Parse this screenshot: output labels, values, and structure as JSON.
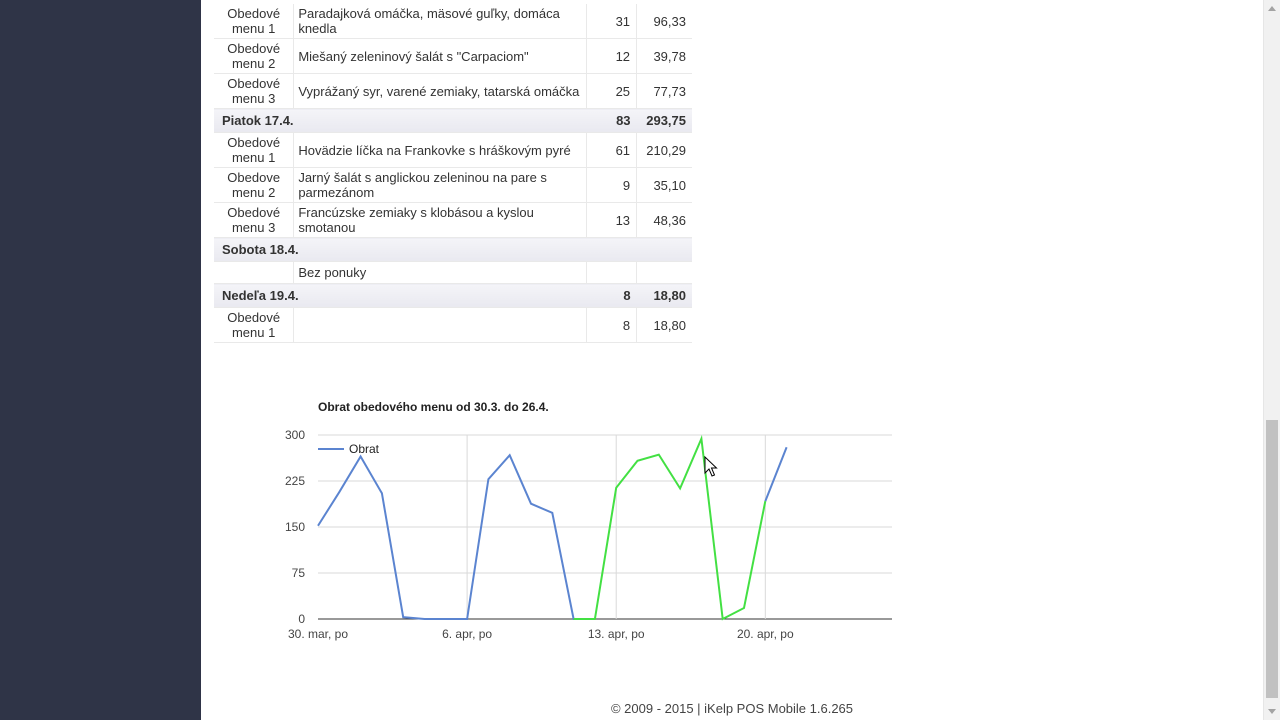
{
  "table": {
    "rows": [
      {
        "kind": "item",
        "menu": "Obedové menu 1",
        "dish": "Paradajková omáčka, mäsové guľky, domáca knedla",
        "qty": "31",
        "sum": "96,33"
      },
      {
        "kind": "item",
        "menu": "Obedové menu 2",
        "dish": "Miešaný zeleninový šalát s \"Carpaciom\"",
        "qty": "12",
        "sum": "39,78"
      },
      {
        "kind": "item",
        "menu": "Obedové menu 3",
        "dish": "Vyprážaný syr, varené zemiaky, tatarská omáčka",
        "qty": "25",
        "sum": "77,73"
      },
      {
        "kind": "day",
        "day": "Piatok 17.4.",
        "qty": "83",
        "sum": "293,75"
      },
      {
        "kind": "item",
        "menu": "Obedové menu 1",
        "dish": "Hovädzie líčka na Frankovke s hráškovým pyré",
        "qty": "61",
        "sum": "210,29"
      },
      {
        "kind": "item",
        "menu": "Obedove menu 2",
        "dish": "Jarný šalát s anglickou zeleninou na pare s parmezánom",
        "qty": "9",
        "sum": "35,10"
      },
      {
        "kind": "item",
        "menu": "Obedové menu 3",
        "dish": "Francúzske zemiaky s klobásou a kyslou smotanou",
        "qty": "13",
        "sum": "48,36"
      },
      {
        "kind": "day",
        "day": "Sobota 18.4.",
        "qty": "",
        "sum": ""
      },
      {
        "kind": "empty",
        "menu": "",
        "dish": "Bez ponuky",
        "qty": "",
        "sum": ""
      },
      {
        "kind": "day",
        "day": "Nedeľa 19.4.",
        "qty": "8",
        "sum": "18,80"
      },
      {
        "kind": "item",
        "menu": "Obedové menu 1",
        "dish": "",
        "qty": "8",
        "sum": "18,80"
      }
    ]
  },
  "chart_data": {
    "type": "line",
    "title": "Obrat obedového menu od 30.3. do 26.4.",
    "xlabel": "",
    "ylabel": "",
    "yticks": [
      "300",
      "225",
      "150",
      "75",
      "0"
    ],
    "ytick_values": [
      300,
      225,
      150,
      75,
      0
    ],
    "xticks": [
      "30. mar, po",
      "6. apr, po",
      "13. apr, po",
      "20. apr, po"
    ],
    "ylim": [
      0,
      300
    ],
    "grid": true,
    "legend_position": "top-left",
    "days": [
      "30.3.",
      "31.3.",
      "1.4.",
      "2.4.",
      "3.4.",
      "4.4.",
      "5.4.",
      "6.4.",
      "7.4.",
      "8.4.",
      "9.4.",
      "10.4.",
      "11.4.",
      "12.4.",
      "13.4.",
      "14.4.",
      "15.4.",
      "16.4.",
      "17.4.",
      "18.4.",
      "19.4.",
      "20.4.",
      "21.4."
    ],
    "series": [
      {
        "name": "Obrat",
        "color": "#5b84d0",
        "values": [
          152,
          207,
          265,
          205,
          3,
          0,
          0,
          0,
          228,
          267,
          188,
          173,
          0,
          0,
          null,
          null,
          null,
          null,
          null,
          null,
          null,
          192,
          280
        ]
      }
    ],
    "highlight": {
      "color": "#43e043",
      "start_index": 12,
      "end_index": 21,
      "values": [
        0,
        0,
        214,
        258,
        268,
        213,
        294,
        0,
        18,
        192
      ]
    }
  },
  "footer": {
    "text": "© 2009 - 2015 | iKelp POS Mobile 1.6.265"
  }
}
